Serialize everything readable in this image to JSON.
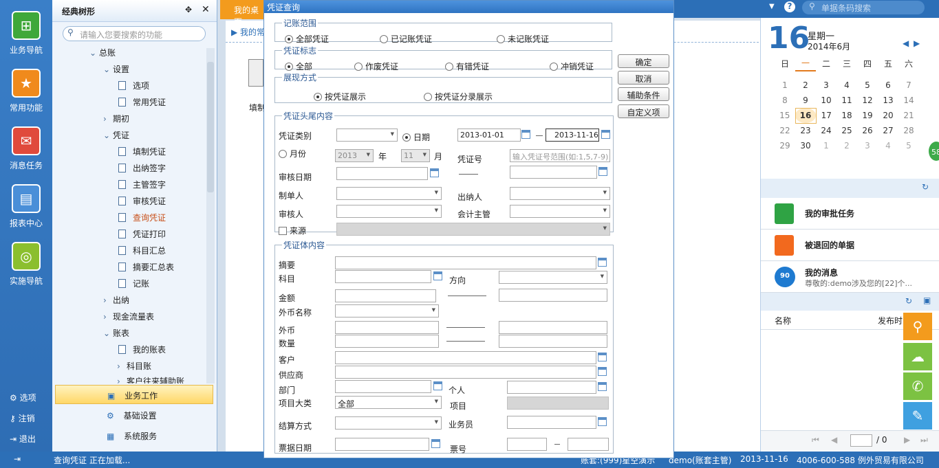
{
  "left_nav": {
    "items": [
      {
        "label": "业务导航",
        "icon": "sitemap-icon"
      },
      {
        "label": "常用功能",
        "icon": "star-icon"
      },
      {
        "label": "消息任务",
        "icon": "mail-icon"
      },
      {
        "label": "报表中心",
        "icon": "report-icon"
      },
      {
        "label": "实施导航",
        "icon": "compass-icon"
      }
    ],
    "bottom": [
      {
        "label": "选项",
        "glyph": "⚙"
      },
      {
        "label": "注销",
        "glyph": "⚷"
      },
      {
        "label": "退出",
        "glyph": "⇥"
      }
    ]
  },
  "tree_panel": {
    "title": "经典树形",
    "search_placeholder": "请输入您要搜索的功能",
    "nodes": [
      {
        "label": "总账",
        "type": "folder-open"
      },
      {
        "label": "设置",
        "type": "folder-open"
      },
      {
        "label": "选项",
        "type": "leaf"
      },
      {
        "label": "常用凭证",
        "type": "leaf"
      },
      {
        "label": "期初",
        "type": "folder"
      },
      {
        "label": "凭证",
        "type": "folder-open"
      },
      {
        "label": "填制凭证",
        "type": "leaf"
      },
      {
        "label": "出纳签字",
        "type": "leaf"
      },
      {
        "label": "主管签字",
        "type": "leaf"
      },
      {
        "label": "审核凭证",
        "type": "leaf"
      },
      {
        "label": "查询凭证",
        "type": "leaf"
      },
      {
        "label": "凭证打印",
        "type": "leaf"
      },
      {
        "label": "科目汇总",
        "type": "leaf"
      },
      {
        "label": "摘要汇总表",
        "type": "leaf"
      },
      {
        "label": "记账",
        "type": "leaf"
      },
      {
        "label": "出纳",
        "type": "folder"
      },
      {
        "label": "现金流量表",
        "type": "folder"
      },
      {
        "label": "账表",
        "type": "folder-open"
      },
      {
        "label": "我的账表",
        "type": "leaf"
      },
      {
        "label": "科目账",
        "type": "folder"
      },
      {
        "label": "客户往来辅助账",
        "type": "folder"
      }
    ],
    "bottom_items": [
      "业务工作",
      "基础设置",
      "系统服务"
    ]
  },
  "desktop": {
    "tab": "我的桌面",
    "subtab": "我的常",
    "icon_label": "填制"
  },
  "topbar": {
    "search_placeholder": "单据条码搜索"
  },
  "calendar": {
    "day": "16",
    "weekday": "星期一",
    "month": "2014年6月",
    "headers": [
      "日",
      "一",
      "二",
      "三",
      "四",
      "五",
      "六"
    ],
    "rows": [
      [
        "1",
        "2",
        "3",
        "4",
        "5",
        "6",
        "7"
      ],
      [
        "8",
        "9",
        "10",
        "11",
        "12",
        "13",
        "14"
      ],
      [
        "15",
        "16",
        "17",
        "18",
        "19",
        "20",
        "21"
      ],
      [
        "22",
        "23",
        "24",
        "25",
        "26",
        "27",
        "28"
      ],
      [
        "29",
        "30",
        "1",
        "2",
        "3",
        "4",
        "5"
      ]
    ],
    "badge": "58"
  },
  "right_panel": {
    "approve": "我的审批任务",
    "returned": "被退回的单据",
    "messages_title": "我的消息",
    "messages_badge": "90",
    "messages_preview": "尊敬的:demo涉及您的[22]个...",
    "col_name": "名称",
    "col_time": "发布时",
    "pager": "/ 0"
  },
  "dialog": {
    "title": "凭证查询",
    "scope": {
      "legend": "记账范围",
      "options": [
        "全部凭证",
        "已记账凭证",
        "未记账凭证"
      ]
    },
    "flag": {
      "legend": "凭证标志",
      "options": [
        "全部",
        "作废凭证",
        "有错凭证",
        "冲销凭证"
      ]
    },
    "display": {
      "legend": "展现方式",
      "options": [
        "按凭证展示",
        "按凭证分录展示"
      ]
    },
    "header": {
      "legend": "凭证头尾内容",
      "type_label": "凭证类别",
      "date_label": "日期",
      "date_from": "2013-01-01",
      "date_to": "2013-11-16",
      "month_label": "月份",
      "year_value": "2013",
      "year_label": "年",
      "month_value": "11",
      "month_unit": "月",
      "no_label": "凭证号",
      "no_placeholder": "输入凭证号范围(如:1,5,7-9)",
      "audit_date_label": "审核日期",
      "maker_label": "制单人",
      "cashier_label": "出纳人",
      "auditor_label": "审核人",
      "supervisor_label": "会计主管",
      "source_label": "来源"
    },
    "body": {
      "legend": "凭证体内容",
      "summary": "摘要",
      "account": "科目",
      "direction": "方向",
      "amount": "金额",
      "currency_name": "外币名称",
      "currency": "外币",
      "quantity": "数量",
      "customer": "客户",
      "supplier": "供应商",
      "department": "部门",
      "person": "个人",
      "project_class": "项目大类",
      "project_class_value": "全部",
      "project": "项目",
      "settle": "结算方式",
      "salesman": "业务员",
      "bill_date": "票据日期",
      "bill_no": "票号"
    },
    "buttons": [
      "确定",
      "取消",
      "辅助条件",
      "自定义项"
    ]
  },
  "status": {
    "loading": "查询凭证 正在加载...",
    "account": "账套:(999)星空演示",
    "user": "demo(账套主管)",
    "date": "2013-11-16",
    "company": "4006-600-588 例外贸易有限公司"
  }
}
